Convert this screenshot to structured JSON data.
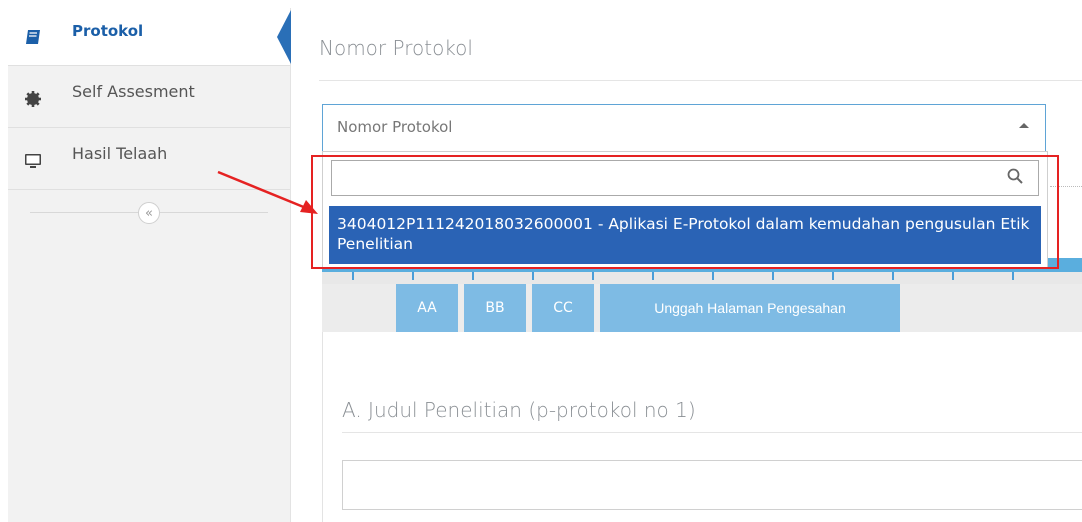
{
  "sidebar": {
    "items": [
      {
        "label": "Protokol",
        "icon": "book-icon",
        "active": true
      },
      {
        "label": "Self Assesment",
        "icon": "gear-icon",
        "active": false
      },
      {
        "label": "Hasil Telaah",
        "icon": "monitor-icon",
        "active": false
      }
    ],
    "collapse_label": "«"
  },
  "main": {
    "title": "Nomor Protokol",
    "select": {
      "placeholder": "Nomor Protokol"
    },
    "dropdown": {
      "search_value": "",
      "highlighted_option": "3404012P111242018032600001 - Aplikasi E-Protokol dalam kemudahan pengusulan Etik Penelitian"
    },
    "tabs": [
      {
        "label": "AA"
      },
      {
        "label": "BB"
      },
      {
        "label": "CC"
      },
      {
        "label": "Unggah Halaman Pengesahan"
      }
    ],
    "section_title": "A. Judul Penelitian (p-protokol no 1)"
  },
  "colors": {
    "accent": "#2a63b5",
    "tab": "#7ebbe4",
    "highlight_box": "#e52222"
  }
}
